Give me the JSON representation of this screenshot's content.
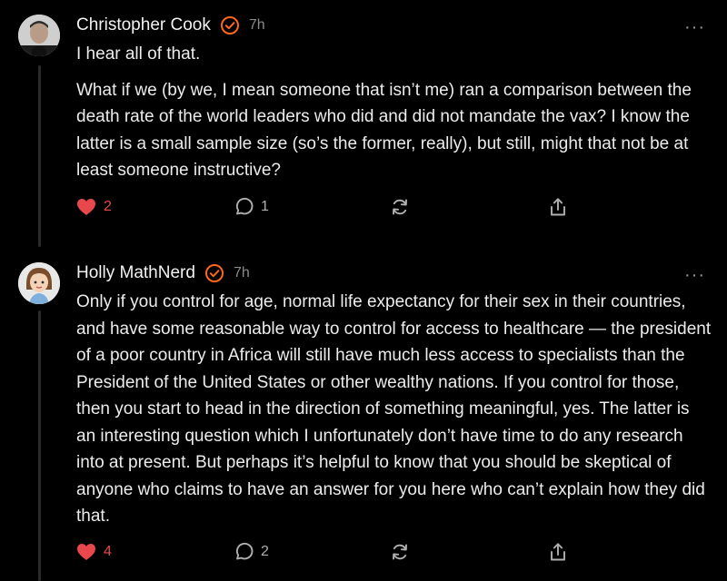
{
  "comments": [
    {
      "author": "Christopher Cook",
      "time": "7h",
      "paragraphs": [
        "I hear all of that.",
        "What if we (by we, I mean someone that isn’t me) ran a comparison between the death rate of the world leaders who did and did not mandate the vax? I know the latter is a small sample size (so’s the former, really), but still, might that not be at least someone instructive?"
      ],
      "likes": "2",
      "replies": "1",
      "more_label": "···"
    },
    {
      "author": "Holly MathNerd",
      "time": "7h",
      "paragraphs": [
        "Only if you control for age, normal life expectancy for their sex in their countries, and have some reasonable way to control for access to healthcare — the president of a poor country in Africa will still have much less access to specialists than the President of the United States or other wealthy nations. If you control for those, then you start to head in the direction of something meaningful, yes. The latter is an interesting question which I unfortunately don’t have time to do any research into at present. But perhaps it’s helpful to know that you should be skeptical of anyone who claims to have an answer for you here who can’t explain how they did that."
      ],
      "likes": "4",
      "replies": "2",
      "more_label": "···"
    }
  ],
  "colors": {
    "background": "#000000",
    "like_red": "#e8484b",
    "verified_orange": "#ff6719",
    "muted": "#8a8a8a"
  },
  "icons": [
    "heart-icon",
    "comment-bubble-icon",
    "restack-icon",
    "share-icon",
    "verified-check-icon",
    "more-options-icon"
  ]
}
